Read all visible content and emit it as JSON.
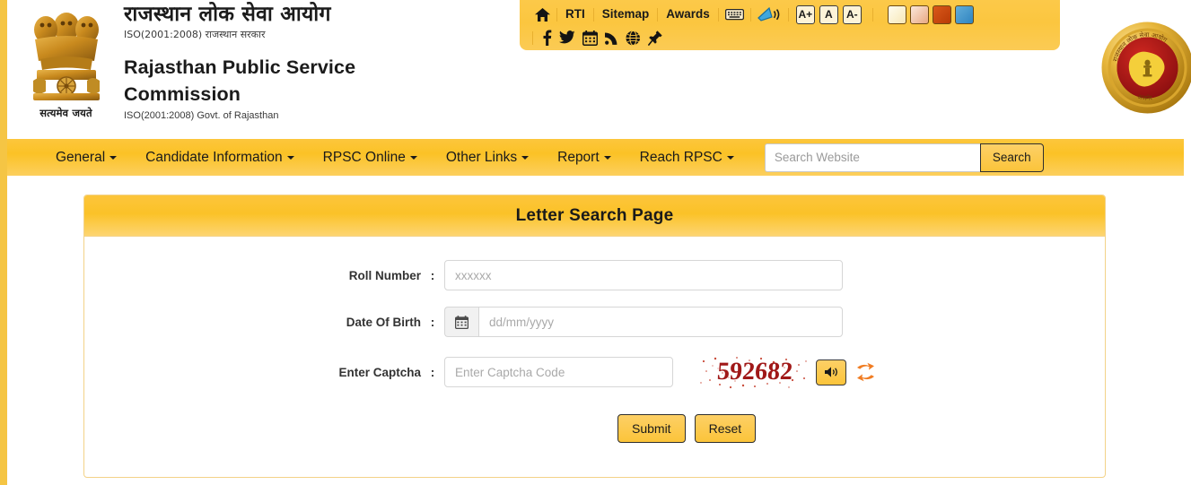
{
  "header": {
    "emblem_left_caption": "सत्यमेव जयते",
    "title_hindi": "राजस्थान लोक सेवा आयोग",
    "iso_hindi": "ISO(2001:2008) राजस्थान सरकार",
    "title_english_line1": "Rajasthan Public Service",
    "title_english_line2": "Commission",
    "iso_english": "ISO(2001:2008) Govt. of Rajasthan"
  },
  "topbar": {
    "home_icon": "home-icon",
    "links": [
      "RTI",
      "Sitemap",
      "Awards"
    ],
    "keyboard_icon": "keyboard-icon",
    "screenreader_icon": "screen-reader-icon",
    "font_sizes": [
      "A+",
      "A",
      "A-"
    ],
    "theme_colors": [
      "#fdf6dc",
      "#f0c3a8",
      "#cc4a12",
      "#4b9ad4"
    ],
    "social_icons": [
      "facebook-icon",
      "twitter-icon",
      "calendar-icon",
      "rss-icon",
      "globe-icon",
      "pin-icon"
    ]
  },
  "nav": {
    "items": [
      {
        "label": "General",
        "has_caret": true
      },
      {
        "label": "Candidate Information",
        "has_caret": true
      },
      {
        "label": "RPSC Online",
        "has_caret": true
      },
      {
        "label": "Other Links",
        "has_caret": true
      },
      {
        "label": "Report",
        "has_caret": true
      },
      {
        "label": "Reach RPSC",
        "has_caret": true
      }
    ],
    "search_placeholder": "Search Website",
    "search_value": "",
    "search_button": "Search"
  },
  "panel": {
    "title": "Letter Search Page",
    "fields": [
      {
        "label": "Roll Number",
        "colon": ":",
        "placeholder": "xxxxxx",
        "value": ""
      },
      {
        "label": "Date Of Birth",
        "colon": ":",
        "placeholder": "dd/mm/yyyy",
        "value": ""
      },
      {
        "label": "Enter Captcha",
        "colon": ":",
        "placeholder": "Enter Captcha Code",
        "value": ""
      }
    ],
    "captcha": {
      "code": "592682",
      "audio_icon": "speaker-icon",
      "refresh_icon": "refresh-icon"
    },
    "buttons": [
      {
        "label": "Submit"
      },
      {
        "label": "Reset"
      }
    ]
  },
  "colors": {
    "brand_yellow": "#fbc426",
    "nav_yellow": "#fcc63c",
    "panel_border": "#f3d288",
    "captcha_red": "#a01818",
    "accent_orange": "#f07c22"
  }
}
